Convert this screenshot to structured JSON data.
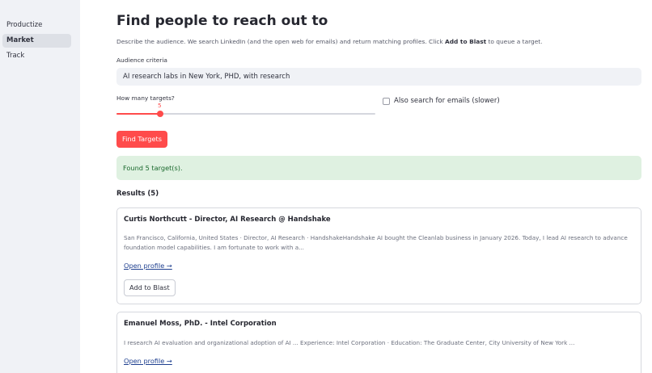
{
  "sidebar": {
    "items": [
      {
        "label": "Productize"
      },
      {
        "label": "Market"
      },
      {
        "label": "Track"
      }
    ]
  },
  "page": {
    "title": "Find people to reach out to",
    "description_pre": "Describe the audience. We search LinkedIn (and the open web for emails) and return matching profiles. Click ",
    "description_bold": "Add to Blast",
    "description_post": " to queue a target."
  },
  "form": {
    "criteria_label": "Audience criteria",
    "criteria_value": "AI research labs in New York, PHD, with research",
    "targets_label": "How many targets?",
    "targets_value": "5",
    "targets_fraction": 0.17,
    "emails_label": "Also search for emails (slower)",
    "emails_checked": false,
    "submit_label": "Find Targets"
  },
  "status": {
    "message": "Found 5 target(s)."
  },
  "results": {
    "heading": "Results (5)",
    "items": [
      {
        "title": "Curtis Northcutt - Director, AI Research @ Handshake",
        "snippet": "San Francisco, California, United States · Director, AI Research · HandshakeHandshake AI bought the Cleanlab business in January 2026. Today, I lead AI research to advance foundation model capabilities. I am fortunate to work with a...",
        "link_label": "Open profile →",
        "button_label": "Add to Blast"
      },
      {
        "title": "Emanuel Moss, PhD. - Intel Corporation",
        "snippet": "I research AI evaluation and organizational adoption of AI ... Experience: Intel Corporation · Education: The Graduate Center, City University of New York ...",
        "link_label": "Open profile →"
      }
    ]
  },
  "colors": {
    "accent": "#ff4b4b",
    "sidebar_bg": "#f0f2f6",
    "success_bg": "#dff1e1",
    "success_text": "#19682c",
    "link": "#1e3f8f"
  }
}
